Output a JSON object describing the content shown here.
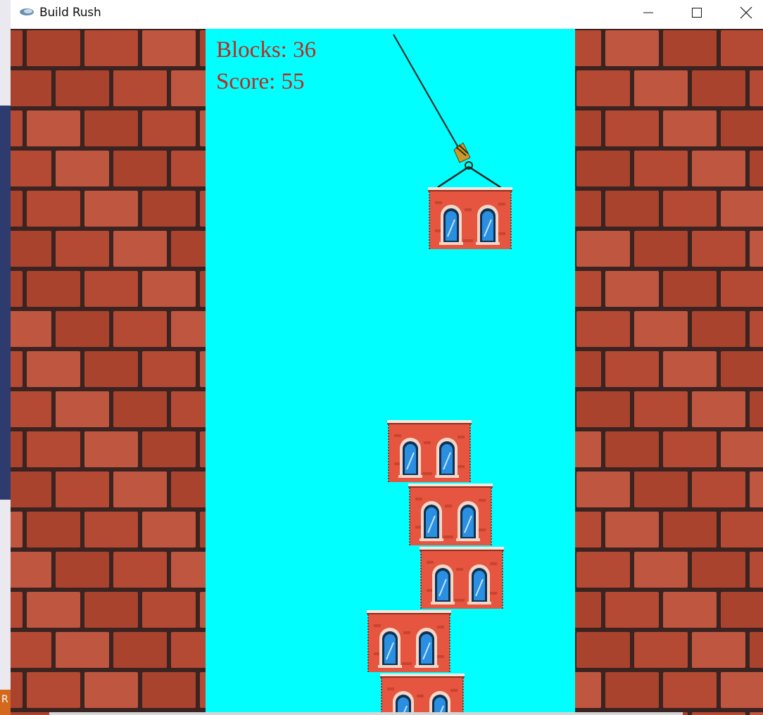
{
  "window": {
    "title": "Build Rush",
    "controls": {
      "minimize": "minimize",
      "maximize": "maximize",
      "close": "close"
    }
  },
  "hud": {
    "blocks_text": "Blocks: 36",
    "score_text": "Score: 55"
  },
  "game": {
    "blocks_count": 36,
    "score": 55,
    "sky_color": "#00ffff",
    "hud_color": "#c0281e",
    "wall_brick_color": "#b44a33",
    "wall_mortar_color": "#3a2320",
    "block_color": "#e5553f",
    "window_glass_color": "#2a8fe0"
  },
  "desktop_edge": {
    "letter": "R"
  }
}
